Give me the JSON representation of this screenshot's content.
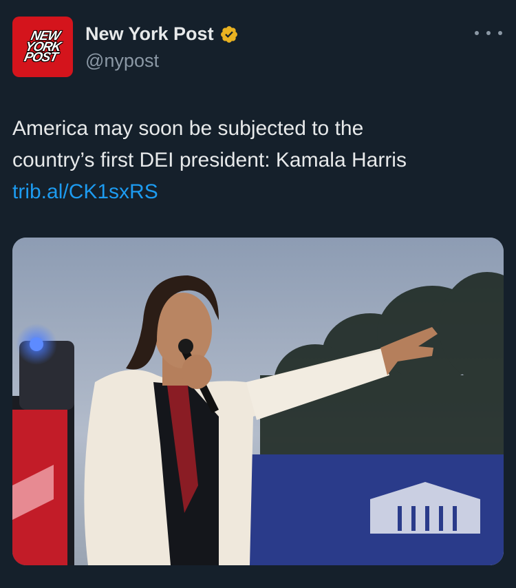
{
  "account": {
    "display_name": "New York Post",
    "handle": "@nypost",
    "avatar_logo_lines": [
      "NEW",
      "YORK",
      "POST"
    ],
    "verified_badge_icon": "verified-gold-badge-icon",
    "badge_color": "#e9b221"
  },
  "more_icon": "more-horizontal-icon",
  "tweet": {
    "text_line_1": "America may soon be subjected to the",
    "text_line_2": "country’s first DEI president: Kamala Harris",
    "link": "trib.al/CK1sxRS"
  },
  "colors": {
    "background": "#15202b",
    "text": "#e7e9ea",
    "secondary_text": "#8b98a5",
    "link": "#1d9bf0",
    "avatar_red": "#d4141c"
  }
}
